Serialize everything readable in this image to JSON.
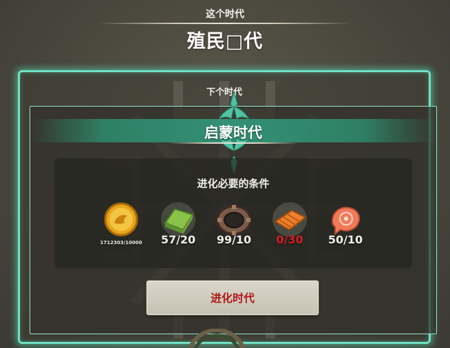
{
  "current_era": {
    "label": "这个时代",
    "name": "殖民□代"
  },
  "next_era": {
    "label": "下个时代",
    "name": "启蒙时代"
  },
  "conditions": {
    "title": "进化必要的条件",
    "resources": [
      {
        "icon": "gold-coin-icon",
        "count": "1712303/10000",
        "sufficient": true
      },
      {
        "icon": "green-ingot-icon",
        "count": "57/20",
        "sufficient": true
      },
      {
        "icon": "gear-ring-icon",
        "count": "99/10",
        "sufficient": true
      },
      {
        "icon": "wood-planks-icon",
        "count": "0/30",
        "sufficient": false
      },
      {
        "icon": "salmon-steak-icon",
        "count": "50/10",
        "sufficient": true
      }
    ]
  },
  "evolve_button": {
    "label": "进化时代"
  },
  "colors": {
    "panel_glow": "#6fe2c4",
    "ribbon_teal": "#2f9676",
    "lacking_red": "#d62020",
    "button_text_red": "#b01818"
  }
}
